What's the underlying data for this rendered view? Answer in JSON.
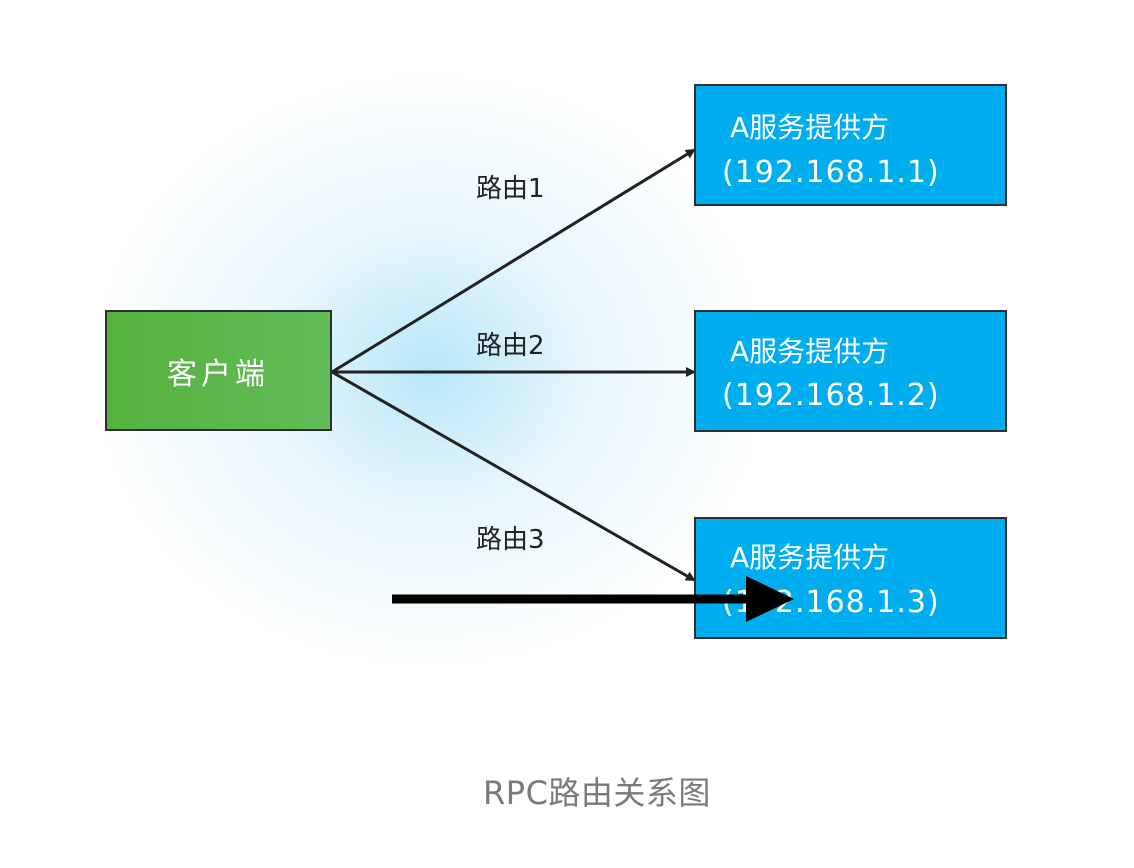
{
  "client": {
    "label": "客户端",
    "color": "#5cb85c"
  },
  "providers": [
    {
      "name": "A服务提供方",
      "address": "(192.168.1.1)"
    },
    {
      "name": "A服务提供方",
      "address": "(192.168.1.2)"
    },
    {
      "name": "A服务提供方",
      "address": "(192.168.1.3)"
    }
  ],
  "provider_color": "#00aeef",
  "routes": [
    {
      "label": "路由1"
    },
    {
      "label": "路由2"
    },
    {
      "label": "路由3"
    }
  ],
  "caption": "RPC路由关系图"
}
